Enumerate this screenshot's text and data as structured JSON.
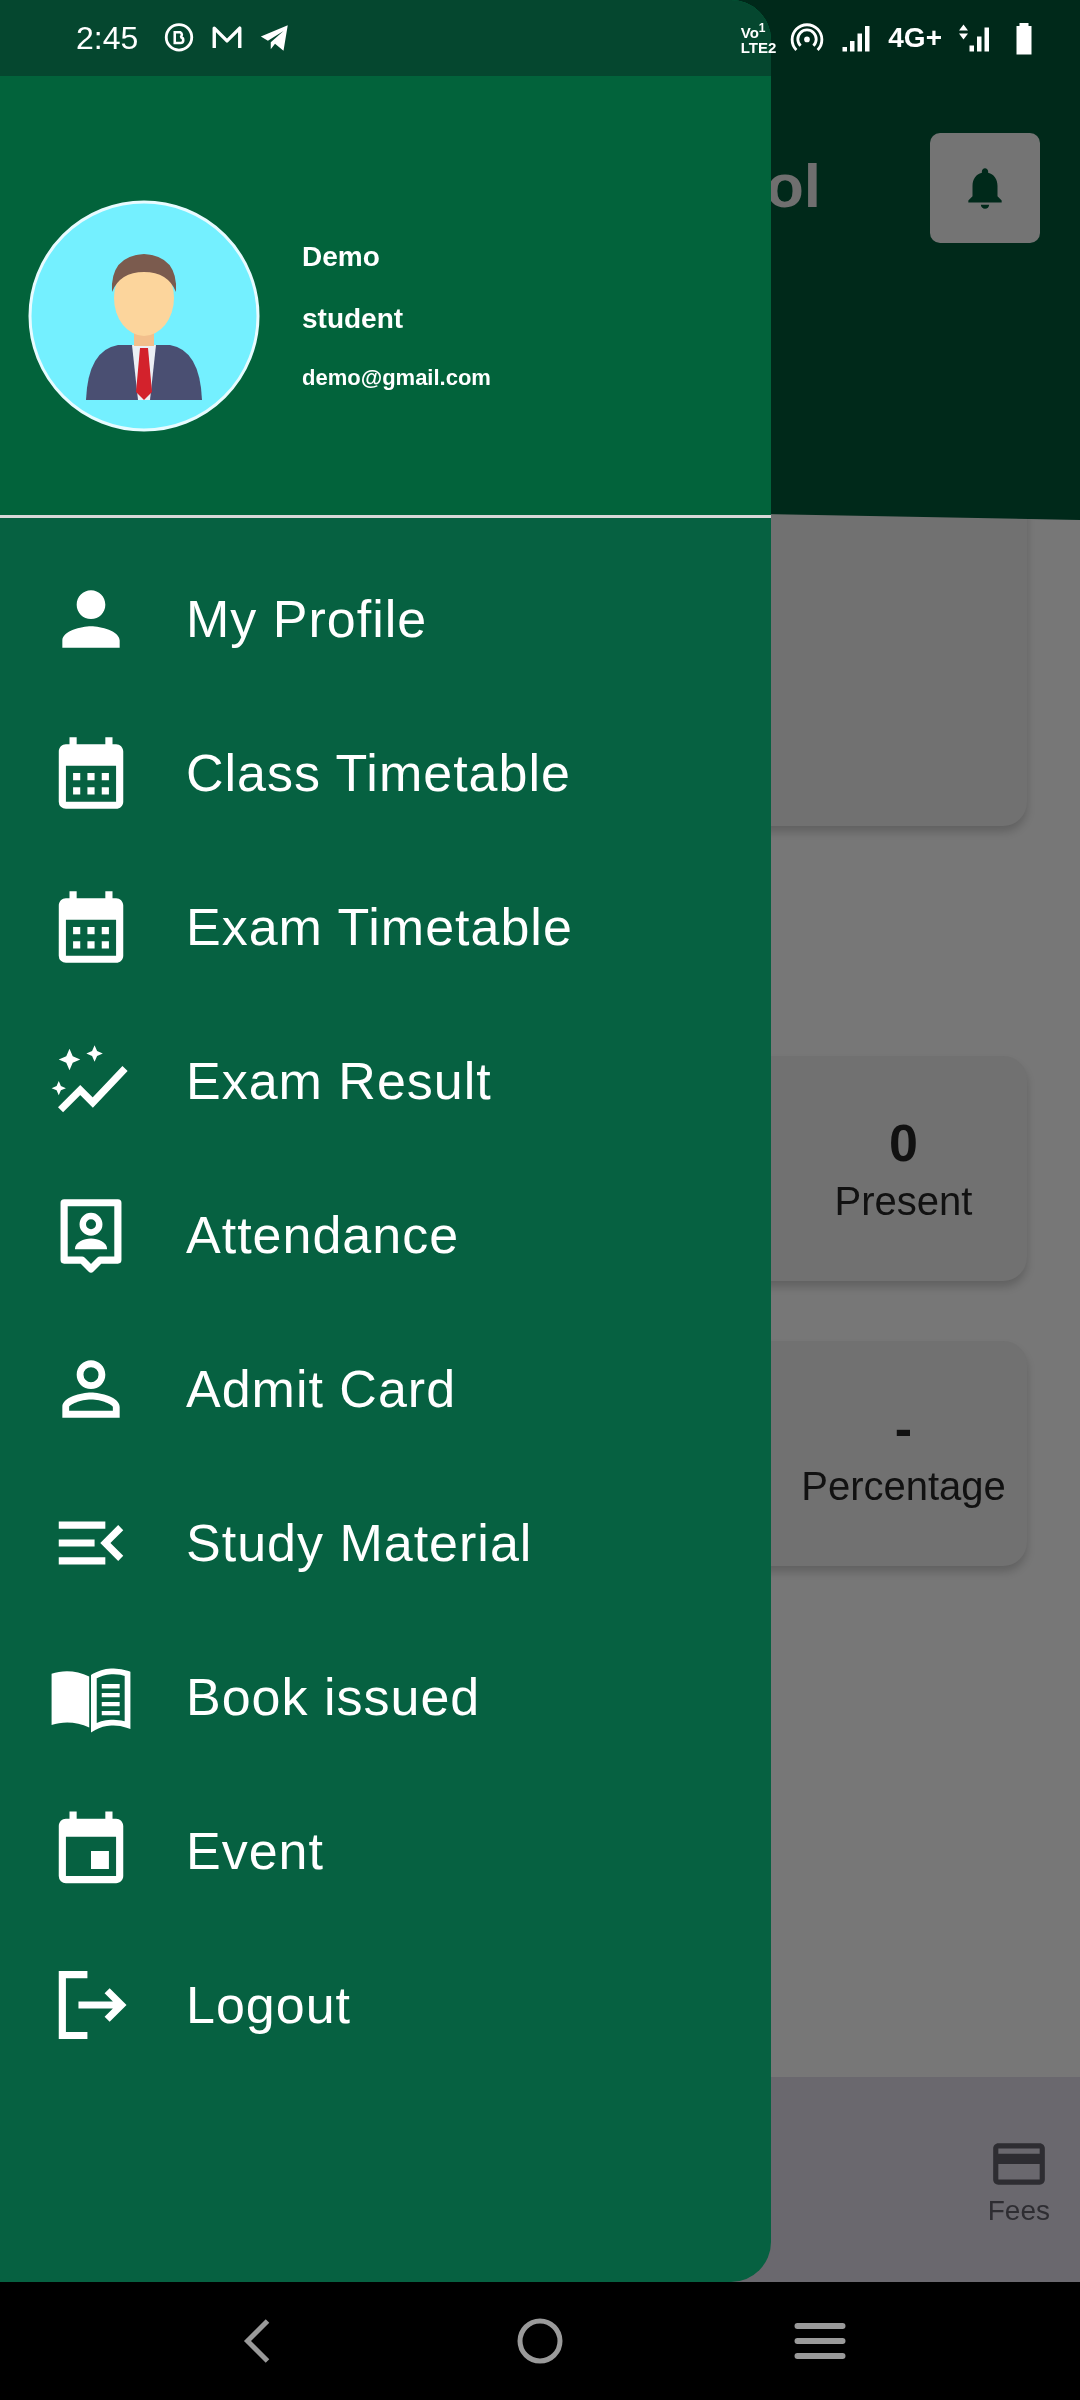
{
  "status_bar": {
    "time": "2:45",
    "volte": [
      "Vo",
      "1",
      "LTE2"
    ],
    "network": "4G+"
  },
  "background": {
    "title_fragment": "ol",
    "stats": [
      {
        "value": "0",
        "label": "Present"
      },
      {
        "value": "-",
        "label": "Percentage"
      }
    ],
    "bottom_nav": [
      {
        "label": "Fees"
      }
    ]
  },
  "drawer": {
    "profile": {
      "name": "Demo",
      "role": "student",
      "email": "demo@gmail.com"
    },
    "items": [
      {
        "label": "My Profile",
        "kind": "person"
      },
      {
        "label": "Class Timetable",
        "kind": "calendar"
      },
      {
        "label": "Exam Timetable",
        "kind": "calendar"
      },
      {
        "label": "Exam Result",
        "kind": "graph"
      },
      {
        "label": "Attendance",
        "kind": "portrait"
      },
      {
        "label": "Admit Card",
        "kind": "outline"
      },
      {
        "label": "Study Material",
        "kind": "list"
      },
      {
        "label": "Book issued",
        "kind": "book"
      },
      {
        "label": "Event",
        "kind": "event"
      },
      {
        "label": "Logout",
        "kind": "logout"
      }
    ]
  }
}
